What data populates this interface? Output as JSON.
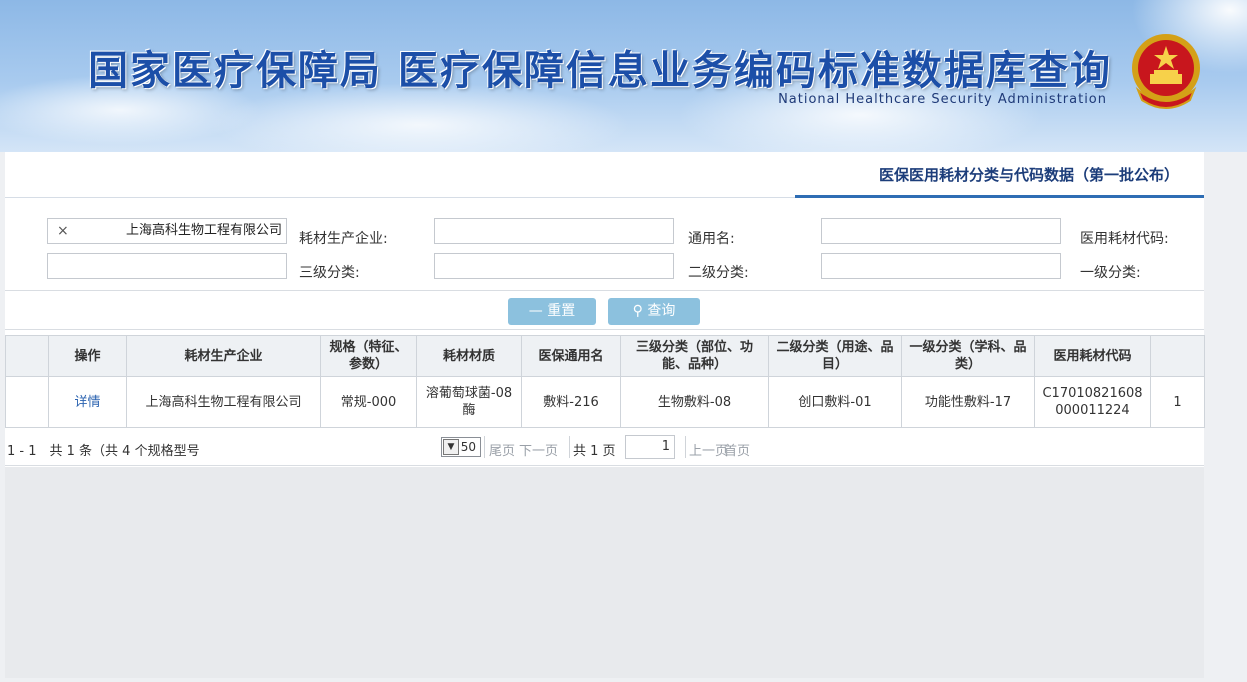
{
  "header": {
    "title_cn": "国家医疗保障局 医疗保障信息业务编码标准数据库查询",
    "title_en": "National Healthcare Security Administration"
  },
  "section": {
    "title": "医保医用耗材分类与代码数据（第一批公布）"
  },
  "filters": {
    "code_label": "医用耗材代码:",
    "code_value": "",
    "common_name_label": "通用名:",
    "common_name_value": "",
    "manufacturer_label": "耗材生产企业:",
    "manufacturer_value": "上海高科生物工程有限公司",
    "clear_icon": "×",
    "level1_label": "一级分类:",
    "level1_value": "",
    "level2_label": "二级分类:",
    "level2_value": "",
    "level3_label": "三级分类:",
    "level3_value": ""
  },
  "buttons": {
    "query_label": "查询",
    "query_icon": "search-icon",
    "reset_label": "重置",
    "reset_icon": "minus-icon"
  },
  "table": {
    "headers": [
      "",
      "医用耗材代码",
      "一级分类（学科、品类）",
      "二级分类（用途、品目）",
      "三级分类（部位、功能、品种）",
      "医保通用名",
      "耗材材质",
      "规格（特征、参数）",
      "耗材生产企业",
      "操作"
    ],
    "rows": [
      {
        "index": "1",
        "code": "C17010821608000011224",
        "level1": "17-功能性敷料",
        "level2": "01-创口敷料",
        "level3": "08-生物敷料",
        "common_name": "216-敷料",
        "material": "08-溶葡萄球菌酶",
        "spec": "000-常规",
        "manufacturer": "上海高科生物工程有限公司",
        "action": "详情"
      }
    ]
  },
  "pager": {
    "first_label": "首页",
    "prev_label": "上一页",
    "current_page": "1",
    "total_pages_text": "共 1 页",
    "next_label": "下一页",
    "last_label": "尾页",
    "page_size": "50",
    "summary": "1 - 1　共 1 条（共 4 个规格型号"
  }
}
